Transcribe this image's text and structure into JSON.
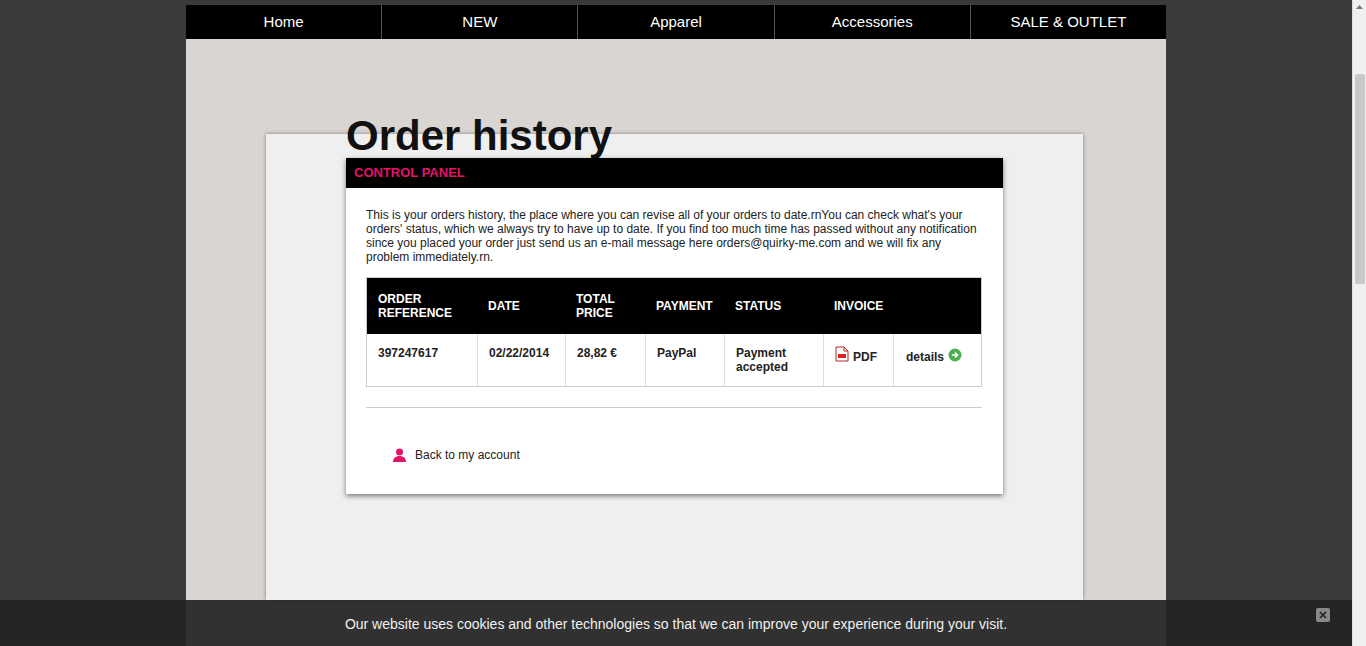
{
  "nav": {
    "items": [
      {
        "label": "Home"
      },
      {
        "label": "NEW"
      },
      {
        "label": "Apparel"
      },
      {
        "label": "Accessories"
      },
      {
        "label": "SALE & OUTLET"
      }
    ]
  },
  "page": {
    "title": "Order history"
  },
  "panel": {
    "header": "CONTROL PANEL",
    "intro": "This is your orders history, the place where you can revise all of your orders to date.rnYou can check what's your orders' status, which we always try to have up to date. If you find too much time has passed without any notification since you placed your order just send us an e-mail message here orders@quirky-me.com and we will fix any problem immediately.rn."
  },
  "table": {
    "columns": [
      "ORDER REFERENCE",
      "DATE",
      "TOTAL PRICE",
      "PAYMENT",
      "STATUS",
      "INVOICE",
      ""
    ],
    "rows": [
      {
        "reference": "397247617",
        "date": "02/22/2014",
        "total": "28,82 €",
        "payment": "PayPal",
        "status": "Payment accepted",
        "invoice": "PDF",
        "details": "details"
      }
    ]
  },
  "back_link": {
    "label": "Back to my account"
  },
  "cookie_bar": {
    "text": "Our website uses cookies and other technologies so that we can improve your experience during your visit."
  }
}
